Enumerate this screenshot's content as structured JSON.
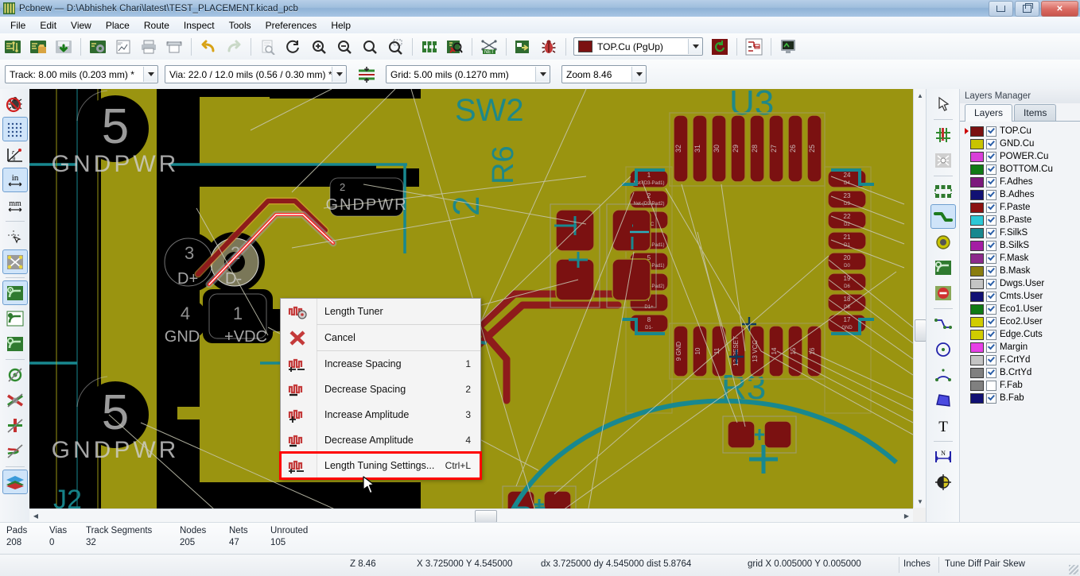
{
  "window": {
    "title": "Pcbnew — D:\\Abhishek Chari\\latest\\TEST_PLACEMENT.kicad_pcb",
    "app_icon": "kicad-pcbnew-icon",
    "minimize_label": "",
    "maximize_label": "",
    "close_label": "✕"
  },
  "menubar": {
    "items": [
      {
        "label": "File"
      },
      {
        "label": "Edit"
      },
      {
        "label": "View"
      },
      {
        "label": "Place"
      },
      {
        "label": "Route"
      },
      {
        "label": "Inspect"
      },
      {
        "label": "Tools"
      },
      {
        "label": "Preferences"
      },
      {
        "label": "Help"
      }
    ]
  },
  "main_toolbar": {
    "buttons": [
      {
        "name": "new-board-icon",
        "tip": "New board"
      },
      {
        "name": "open-board-icon",
        "tip": "Open board"
      },
      {
        "name": "save-board-icon",
        "tip": "Save board"
      },
      {
        "name": "board-setup-icon",
        "tip": "Board setup"
      },
      {
        "name": "page-settings-icon",
        "tip": "Page settings"
      },
      {
        "name": "print-icon",
        "tip": "Print board"
      },
      {
        "name": "plot-icon",
        "tip": "Plot"
      },
      {
        "name": "undo-icon",
        "tip": "Undo"
      },
      {
        "name": "redo-icon",
        "tip": "Redo"
      },
      {
        "name": "find-icon",
        "tip": "Find"
      },
      {
        "name": "refresh-icon",
        "tip": "Refresh"
      },
      {
        "name": "zoom-in-icon",
        "tip": "Zoom in"
      },
      {
        "name": "zoom-out-icon",
        "tip": "Zoom out"
      },
      {
        "name": "zoom-fit-icon",
        "tip": "Zoom to fit"
      },
      {
        "name": "zoom-area-icon",
        "tip": "Zoom to selection"
      },
      {
        "name": "footprint-editor-icon",
        "tip": "Footprint editor"
      },
      {
        "name": "footprint-viewer-icon",
        "tip": "Footprint viewer"
      },
      {
        "name": "netlist-icon",
        "tip": "Load netlist"
      },
      {
        "name": "drc-icon",
        "tip": "Design rules check"
      },
      {
        "name": "bug-icon",
        "tip": "Run DRC"
      }
    ],
    "active_layer": {
      "label": "TOP.Cu (PgUp)",
      "color": "#7b1111"
    },
    "buttons_tail": [
      {
        "name": "rotate-via-icon",
        "tip": "Via properties"
      },
      {
        "name": "net-highlight-icon",
        "tip": "Net highlight"
      },
      {
        "name": "3d-viewer-icon",
        "tip": "3D viewer"
      }
    ]
  },
  "aux_toolbar": {
    "track_width": "Track: 8.00 mils (0.203 mm) *",
    "via_size": "Via: 22.0 / 12.0 mils (0.56 / 0.30 mm) *",
    "autotrack_icon": "auto-track-width-icon",
    "grid": "Grid: 5.00 mils (0.1270 mm)",
    "zoom": "Zoom 8.46"
  },
  "left_toolbar": {
    "items": [
      {
        "name": "drc-off-icon",
        "active": false,
        "tip": "Disable DRC"
      },
      {
        "name": "grid-toggle-icon",
        "active": true,
        "tip": "Show grid"
      },
      {
        "name": "polar-coords-icon",
        "active": false,
        "tip": "Polar coordinates"
      },
      {
        "name": "units-inches-icon",
        "active": true,
        "tip": "Units in inches",
        "label": "in"
      },
      {
        "name": "units-mm-icon",
        "active": false,
        "tip": "Units in millimeters",
        "label": "mm"
      },
      {
        "name": "cursor-shape-icon",
        "active": false,
        "tip": "Full window crosshair"
      },
      {
        "name": "ratsnest-toggle-icon",
        "active": true,
        "tip": "Show ratsnest"
      },
      {
        "name": "zone-filled-icon",
        "active": true,
        "tip": "Show filled zones"
      },
      {
        "name": "zone-outline-icon",
        "active": false,
        "tip": "Show zone outlines"
      },
      {
        "name": "zone-sketch-icon",
        "active": false,
        "tip": "Show sketch zones"
      },
      {
        "name": "via-sketch-icon",
        "active": false,
        "tip": "Show vias in sketch mode"
      },
      {
        "name": "track-sketch-icon",
        "active": false,
        "tip": "Show tracks in sketch mode"
      },
      {
        "name": "pad-sketch-icon",
        "active": false,
        "tip": "Show pads in sketch mode"
      },
      {
        "name": "graphic-sketch-icon",
        "active": false,
        "tip": "Sketch graphic items"
      },
      {
        "name": "contrast-mode-icon",
        "active": true,
        "tip": "High contrast display mode"
      }
    ]
  },
  "right_toolbar": {
    "items": [
      {
        "name": "select-tool-icon",
        "active": false,
        "tip": "Select item"
      },
      {
        "name": "highlight-net-icon",
        "active": false,
        "tip": "Highlight net"
      },
      {
        "name": "local-ratsnest-icon",
        "active": false,
        "tip": "Local ratsnest"
      },
      {
        "name": "add-footprint-icon",
        "active": false,
        "tip": "Add footprint"
      },
      {
        "name": "route-track-icon",
        "active": true,
        "tip": "Route tracks"
      },
      {
        "name": "add-via-icon",
        "active": false,
        "tip": "Add via"
      },
      {
        "name": "add-zone-icon",
        "active": false,
        "tip": "Add filled zone"
      },
      {
        "name": "add-keepout-icon",
        "active": false,
        "tip": "Add keepout area"
      },
      {
        "name": "add-line-icon",
        "active": false,
        "tip": "Add graphic line"
      },
      {
        "name": "add-circle-icon",
        "active": false,
        "tip": "Add graphic circle"
      },
      {
        "name": "add-arc-icon",
        "active": false,
        "tip": "Add graphic arc"
      },
      {
        "name": "add-polygon-icon",
        "active": false,
        "tip": "Add graphic polygon"
      },
      {
        "name": "add-text-icon",
        "active": false,
        "tip": "Add text"
      },
      {
        "name": "add-dimension-icon",
        "active": false,
        "tip": "Add dimension"
      },
      {
        "name": "set-origin-icon",
        "active": false,
        "tip": "Place drill/place origin"
      }
    ]
  },
  "context_menu": {
    "items": [
      {
        "label": "Length Tuner",
        "accel": "",
        "icon": "length-tuner-settings-icon",
        "divider_after": true,
        "highlighted": false
      },
      {
        "label": "Cancel",
        "accel": "",
        "icon": "cancel-x-icon",
        "divider_after": true,
        "highlighted": false
      },
      {
        "label": "Increase Spacing",
        "accel": "1",
        "icon": "increase-spacing-icon",
        "divider_after": false,
        "highlighted": false
      },
      {
        "label": "Decrease Spacing",
        "accel": "2",
        "icon": "decrease-spacing-icon",
        "divider_after": false,
        "highlighted": false
      },
      {
        "label": "Increase Amplitude",
        "accel": "3",
        "icon": "increase-amplitude-icon",
        "divider_after": false,
        "highlighted": false
      },
      {
        "label": "Decrease Amplitude",
        "accel": "4",
        "icon": "decrease-amplitude-icon",
        "divider_after": false,
        "highlighted": false
      },
      {
        "label": "Length Tuning Settings...",
        "accel": "Ctrl+L",
        "icon": "length-tuning-settings-icon",
        "divider_after": false,
        "highlighted": true
      }
    ],
    "highlight_color": "#ff0000"
  },
  "layers_manager": {
    "title": "Layers Manager",
    "tabs": [
      {
        "label": "Layers",
        "active": true
      },
      {
        "label": "Items",
        "active": false
      }
    ],
    "layers": [
      {
        "name": "TOP.Cu",
        "color": "#7b1111",
        "visible": true,
        "selected": true
      },
      {
        "name": "GND.Cu",
        "color": "#c9c400",
        "visible": true,
        "selected": false
      },
      {
        "name": "POWER.Cu",
        "color": "#d93fd9",
        "visible": true,
        "selected": false
      },
      {
        "name": "BOTTOM.Cu",
        "color": "#0f7a14",
        "visible": true,
        "selected": false
      },
      {
        "name": "F.Adhes",
        "color": "#7c1a7c",
        "visible": true,
        "selected": false
      },
      {
        "name": "B.Adhes",
        "color": "#111174",
        "visible": true,
        "selected": false
      },
      {
        "name": "F.Paste",
        "color": "#8b1111",
        "visible": true,
        "selected": false
      },
      {
        "name": "B.Paste",
        "color": "#2bc8d6",
        "visible": true,
        "selected": false
      },
      {
        "name": "F.SilkS",
        "color": "#18888f",
        "visible": true,
        "selected": false
      },
      {
        "name": "B.SilkS",
        "color": "#a41da4",
        "visible": true,
        "selected": false
      },
      {
        "name": "F.Mask",
        "color": "#8c2a8c",
        "visible": true,
        "selected": false
      },
      {
        "name": "B.Mask",
        "color": "#8a7d0e",
        "visible": true,
        "selected": false
      },
      {
        "name": "Dwgs.User",
        "color": "#c4c4c4",
        "visible": true,
        "selected": false
      },
      {
        "name": "Cmts.User",
        "color": "#111174",
        "visible": true,
        "selected": false
      },
      {
        "name": "Eco1.User",
        "color": "#0f7a14",
        "visible": true,
        "selected": false
      },
      {
        "name": "Eco2.User",
        "color": "#d1cc00",
        "visible": true,
        "selected": false
      },
      {
        "name": "Edge.Cuts",
        "color": "#d1cc00",
        "visible": true,
        "selected": false
      },
      {
        "name": "Margin",
        "color": "#e63fe6",
        "visible": true,
        "selected": false
      },
      {
        "name": "F.CrtYd",
        "color": "#c4c4c4",
        "visible": true,
        "selected": false
      },
      {
        "name": "B.CrtYd",
        "color": "#808080",
        "visible": true,
        "selected": false
      },
      {
        "name": "F.Fab",
        "color": "#808080",
        "visible": false,
        "selected": false
      },
      {
        "name": "B.Fab",
        "color": "#111174",
        "visible": true,
        "selected": false
      }
    ]
  },
  "canvas": {
    "background": "#000000",
    "copper_fill": "#9a9410",
    "pad_color": "#7b1111",
    "silk_color": "#18888f",
    "ratsnest_color": "#c8c8b4",
    "selected_track": "#ff2020",
    "references": [
      "SW2",
      "R6",
      "U3",
      "R3",
      "J2",
      "5"
    ],
    "pad_labels": [
      "GNDPWR",
      "D+",
      "D-",
      "GND",
      "+VDC",
      "3",
      "2",
      "4",
      "1",
      "5"
    ],
    "u3_top_pads": [
      "32",
      "31",
      "30",
      "29",
      "28",
      "27",
      "26",
      "25"
    ],
    "u3_left_pads": [
      "1",
      "2",
      "3",
      "4",
      "5",
      "6",
      "7",
      "8"
    ],
    "u3_right_pads": [
      "24",
      "23",
      "22",
      "21",
      "20",
      "19",
      "18",
      "17"
    ],
    "u3_bottom_pads": [
      "9",
      "10",
      "11",
      "12",
      "13",
      "14",
      "15",
      "16"
    ]
  },
  "status_counts": [
    {
      "key": "Pads",
      "value": "208"
    },
    {
      "key": "Vias",
      "value": "0"
    },
    {
      "key": "Track Segments",
      "value": "32"
    },
    {
      "key": "Nodes",
      "value": "205"
    },
    {
      "key": "Nets",
      "value": "47"
    },
    {
      "key": "Unrouted",
      "value": "105"
    }
  ],
  "bottom_bar": {
    "zoom": "Z 8.46",
    "abs_coords": "X 3.725000  Y 4.545000",
    "rel_coords": "dx 3.725000  dy 4.545000  dist 5.8764",
    "grid": "grid X 0.005000  Y 0.005000",
    "units": "Inches",
    "tool_hint": "Tune Diff Pair Skew"
  }
}
